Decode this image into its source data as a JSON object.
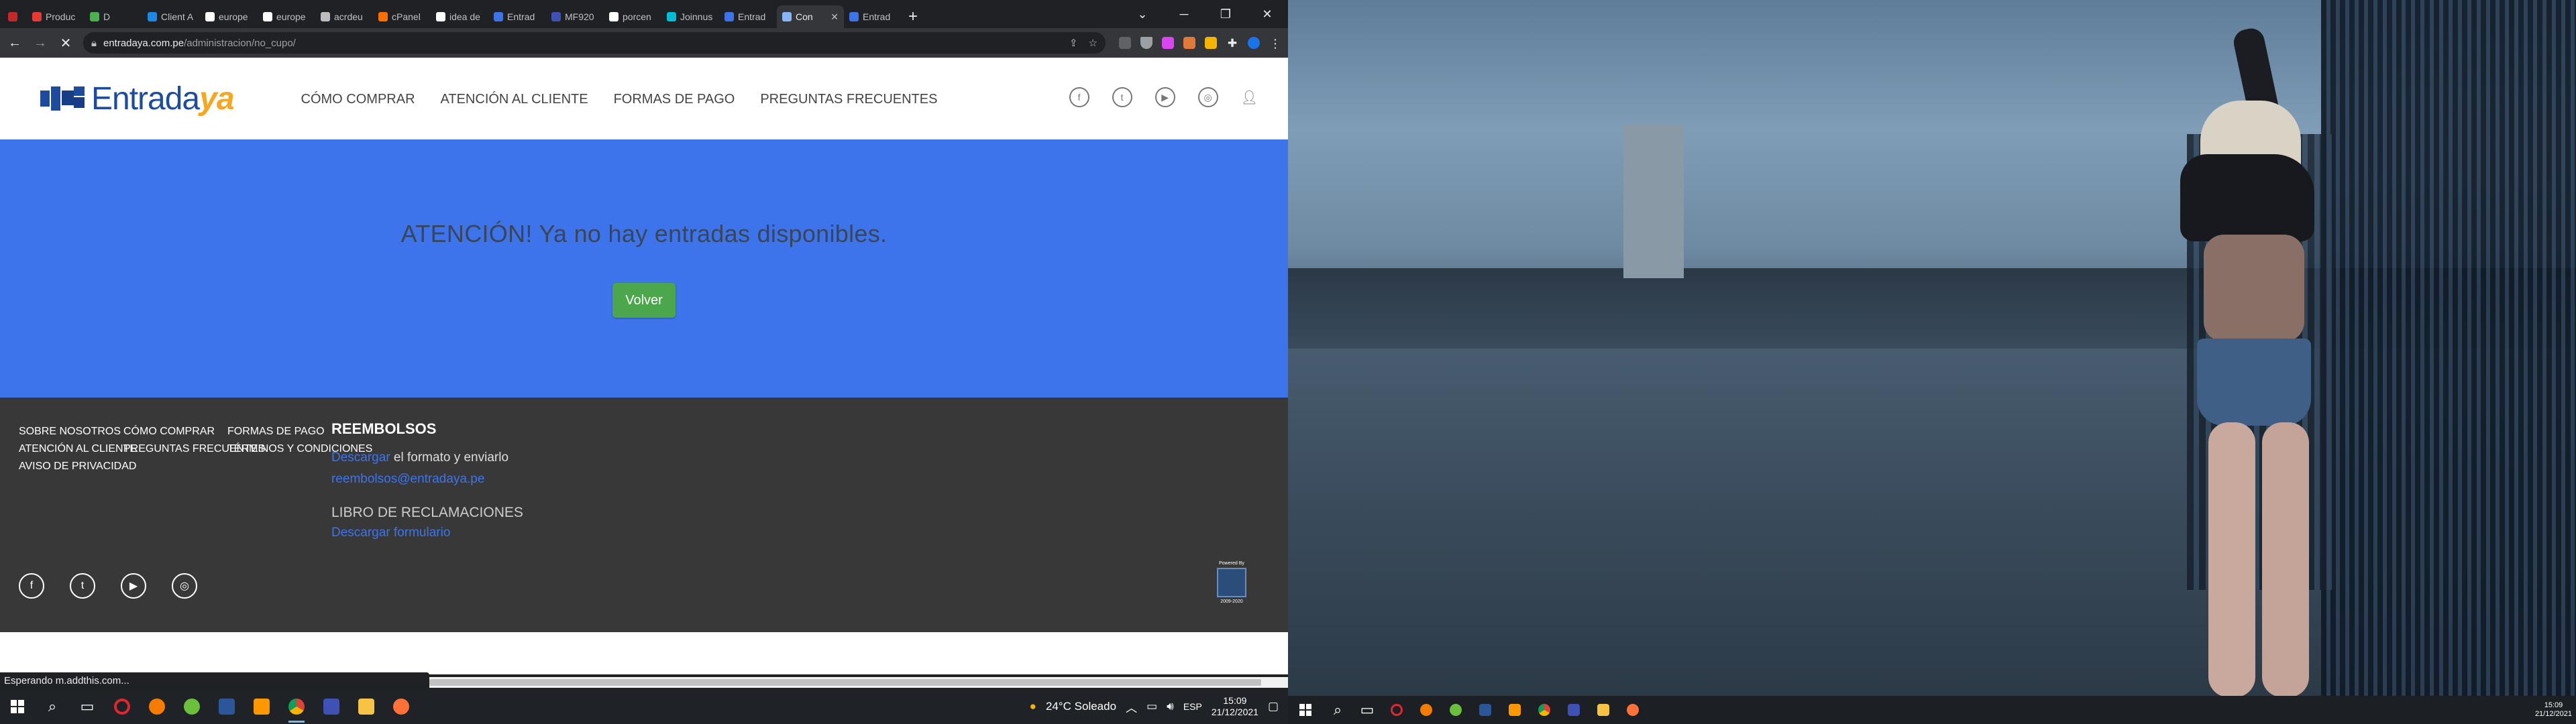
{
  "browser": {
    "tabs": [
      {
        "label": "Produc",
        "favicon_color": "#e53935"
      },
      {
        "label": "D",
        "favicon_color": "#4caf50"
      },
      {
        "label": "Client A",
        "favicon_color": "#1e88e5"
      },
      {
        "label": "europe",
        "favicon_color": "#ffffff"
      },
      {
        "label": "europe",
        "favicon_color": "#ffffff"
      },
      {
        "label": "acrdeu",
        "favicon_color": "#bdbdbd"
      },
      {
        "label": "cPanel",
        "favicon_color": "#ff6f00"
      },
      {
        "label": "idea de",
        "favicon_color": "#ffffff"
      },
      {
        "label": "Entrad",
        "favicon_color": "#3d74ec"
      },
      {
        "label": "MF920",
        "favicon_color": "#3f51b5"
      },
      {
        "label": "porcen",
        "favicon_color": "#ffffff"
      },
      {
        "label": "Joinnus",
        "favicon_color": "#00bcd4"
      },
      {
        "label": "Entrad",
        "favicon_color": "#3d74ec"
      },
      {
        "label": "Con",
        "favicon_color": "#8ab4f8"
      },
      {
        "label": "Entrad",
        "favicon_color": "#3d74ec"
      }
    ],
    "active_tab_index": 13,
    "url_host": "entradaya.com.pe",
    "url_path": "/administracion/no_cupo/"
  },
  "site": {
    "logo_main": "Entrada",
    "logo_accent": "ya",
    "nav": [
      "CÓMO COMPRAR",
      "ATENCIÓN AL CLIENTE",
      "FORMAS DE PAGO",
      "PREGUNTAS FRECUENTES"
    ],
    "message": "ATENCIÓN! Ya no hay entradas disponibles.",
    "back_button": "Volver",
    "colors": {
      "brand_blue": "#3d74ec",
      "button_green": "#4ca64c",
      "footer_bg": "#383838",
      "logo_accent": "#f5a623"
    }
  },
  "footer": {
    "col1": [
      "SOBRE NOSOTROS",
      "ATENCIÓN AL CLIENTE",
      "AVISO DE PRIVACIDAD"
    ],
    "col2": [
      "CÓMO COMPRAR",
      "PREGUNTAS FRECUENTES"
    ],
    "col3": [
      "FORMAS DE PAGO",
      "TÉRMINOS Y CONDICIONES"
    ],
    "refunds_title": "REEMBOLSOS",
    "refunds_link": "Descargar",
    "refunds_text": " el formato y enviarlo",
    "refunds_email": "reembolsos@entradaya.pe",
    "claims_title": "LIBRO DE RECLAMACIONES",
    "claims_link": "Descargar formulario",
    "badge_top": "Powered By",
    "badge_bottom": "2009-2020"
  },
  "status_bar": "Esperando m.addthis.com...",
  "taskbar": {
    "weather": "24°C  Soleado",
    "lang": "ESP",
    "time": "15:09",
    "date": "21/12/2021",
    "time_right": "15:09",
    "date_right": "21/12/2021"
  }
}
